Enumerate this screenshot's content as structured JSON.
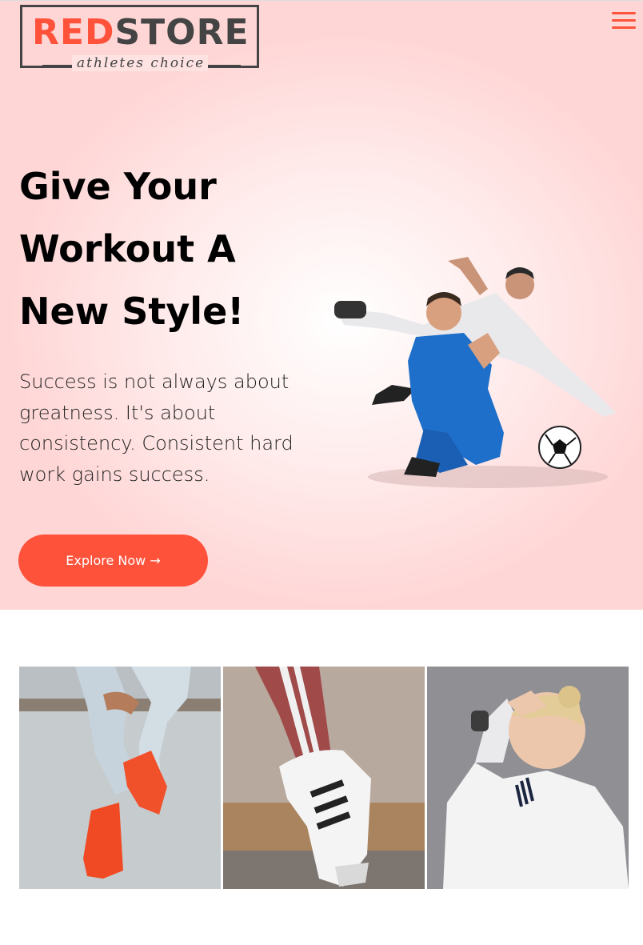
{
  "brand": {
    "name_red": "RED",
    "name_dark": "STORE",
    "tagline": "athletes choice",
    "accent_color": "#ff523b"
  },
  "nav": {
    "menu_icon": "hamburger-menu-icon"
  },
  "hero": {
    "headline_line1": "Give Your",
    "headline_line2": "Workout A",
    "headline_line3": "New Style!",
    "subtext": "Success is not always about greatness. It's about consistency. Consistent hard work gains success.",
    "cta_label": "Explore Now →",
    "image": "soccer-players-illustration"
  },
  "gallery": {
    "items": [
      {
        "image": "red-sneakers-jeans-photo"
      },
      {
        "image": "striped-sneaker-photo"
      },
      {
        "image": "woman-white-hoodie-photo"
      }
    ]
  }
}
